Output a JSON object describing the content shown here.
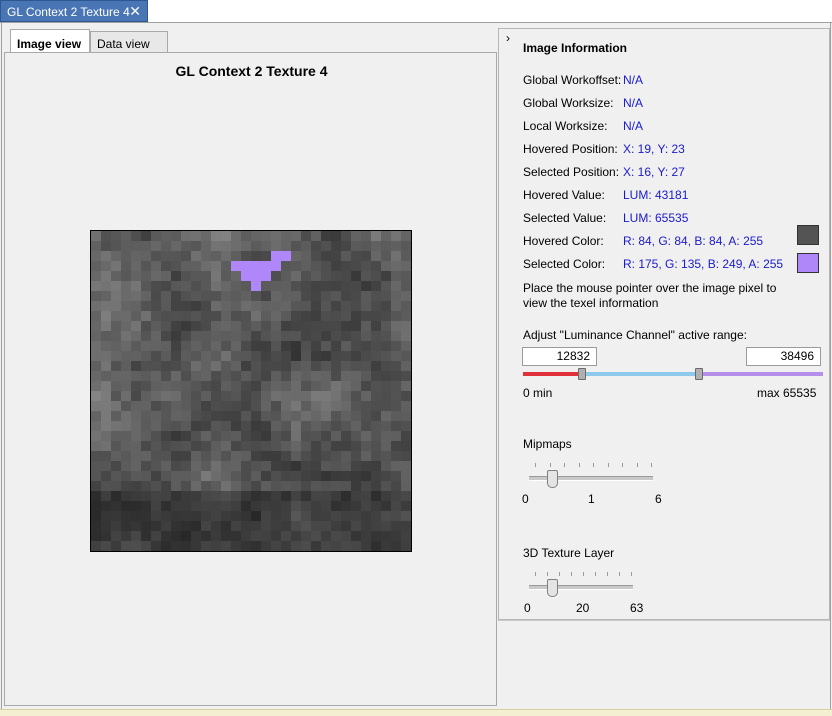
{
  "doc_tab": {
    "title": "GL Context 2 Texture 4",
    "close": "✕"
  },
  "view_tabs": [
    {
      "label": "Image view",
      "active": true
    },
    {
      "label": "Data view",
      "active": false
    }
  ],
  "image_view": {
    "title": "GL Context 2 Texture 4"
  },
  "panel": {
    "collapse_glyph": "›",
    "title": "Image Information",
    "rows": [
      {
        "label": "Global Workoffset:",
        "value": "N/A"
      },
      {
        "label": "Global Worksize:",
        "value": "N/A"
      },
      {
        "label": "Local Worksize:",
        "value": "N/A"
      },
      {
        "label": "Hovered Position:",
        "value": "X: 19, Y: 23"
      },
      {
        "label": "Selected Position:",
        "value": "X: 16, Y: 27"
      },
      {
        "label": "Hovered Value:",
        "value": "LUM: 43181"
      },
      {
        "label": "Selected Value:",
        "value": "LUM: 65535"
      },
      {
        "label": "Hovered Color:",
        "value": "R: 84, G: 84, B: 84, A: 255",
        "swatch": "#545454"
      },
      {
        "label": "Selected Color:",
        "value": "R: 175, G: 135, B: 249, A: 255",
        "swatch": "#af87f9"
      }
    ],
    "hint": "Place the mouse pointer over the image pixel to view the texel information",
    "range": {
      "label": "Adjust \"Luminance Channel\" active range:",
      "low": "12832",
      "high": "38496",
      "min_label": "0 min",
      "max_label": "max 65535",
      "min": 0,
      "max": 65535,
      "low_value": 12832,
      "high_value": 38496
    },
    "mipmaps": {
      "label": "Mipmaps",
      "min": "0",
      "mid": "1",
      "max": "6",
      "value": 0.2
    },
    "layer": {
      "label": "3D Texture Layer",
      "min": "0",
      "mid": "20",
      "max": "63",
      "value": 14
    }
  },
  "colors": {
    "selected_highlight": "#af87f9",
    "accent_tab": "#4a75b5",
    "value_text": "#1a1acc"
  }
}
